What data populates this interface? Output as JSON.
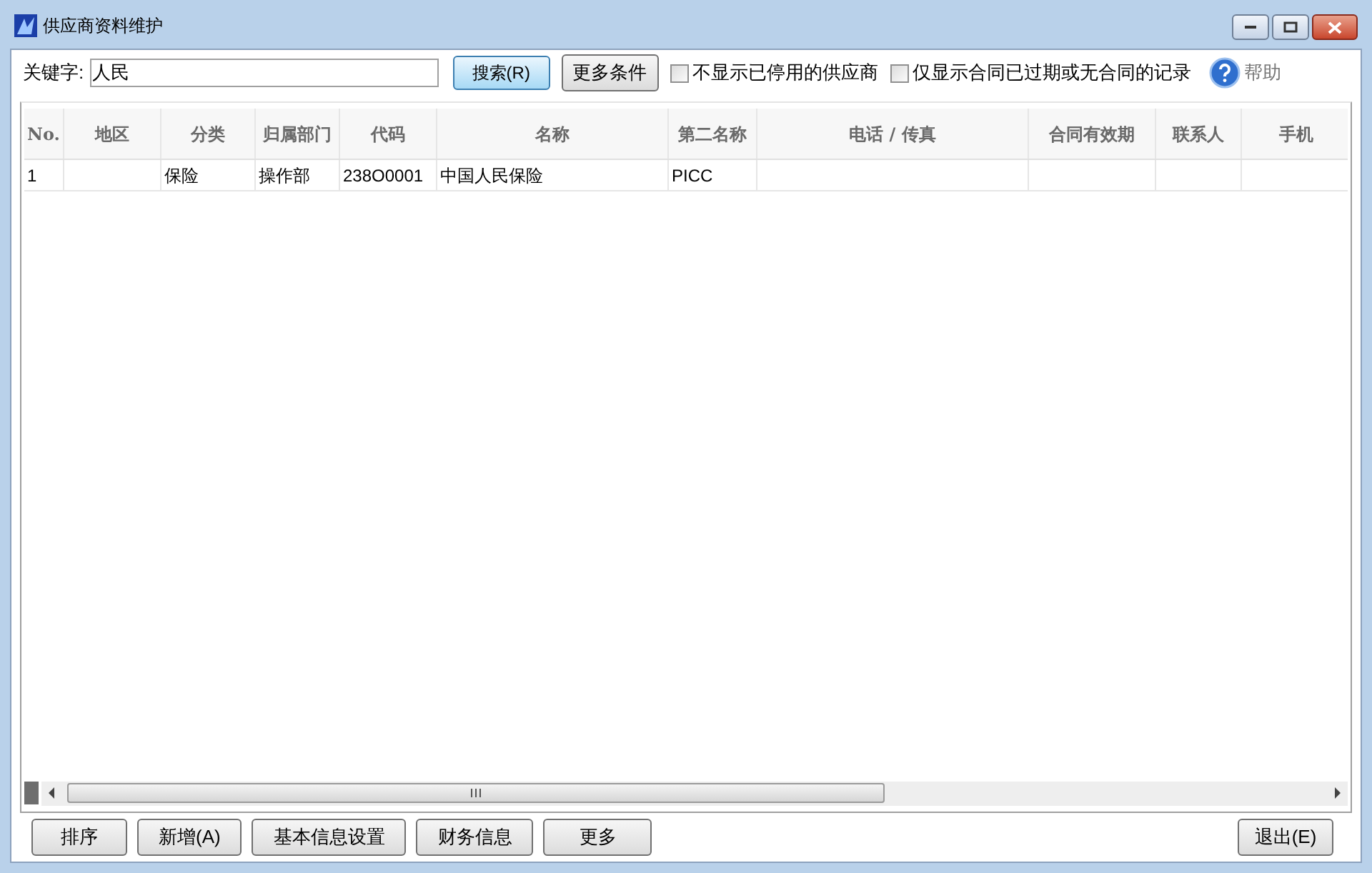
{
  "window": {
    "title": "供应商资料维护"
  },
  "search": {
    "label": "关键字:",
    "value": "人民"
  },
  "toolbar": {
    "search_button": "搜索(R)",
    "more_button": "更多条件",
    "checkboxes": [
      {
        "label": "不显示已停用的供应商",
        "checked": false
      },
      {
        "label": "仅显示合同已过期或无合同的记录",
        "checked": false
      }
    ],
    "help": "帮助"
  },
  "table": {
    "columns": [
      "No.",
      "地区",
      "分类",
      "归属部门",
      "代码",
      "名称",
      "第二名称",
      "电话 / 传真",
      "合同有效期",
      "联系人",
      "手机"
    ],
    "rows": [
      [
        "1",
        "",
        "保险",
        "操作部",
        "238O0001",
        "中国人民保险",
        "PICC",
        "",
        "",
        "",
        ""
      ]
    ]
  },
  "buttons": [
    "排序",
    "新增(A)",
    "基本信息设置",
    "财务信息",
    "更多"
  ],
  "exit_button": "退出(E)"
}
